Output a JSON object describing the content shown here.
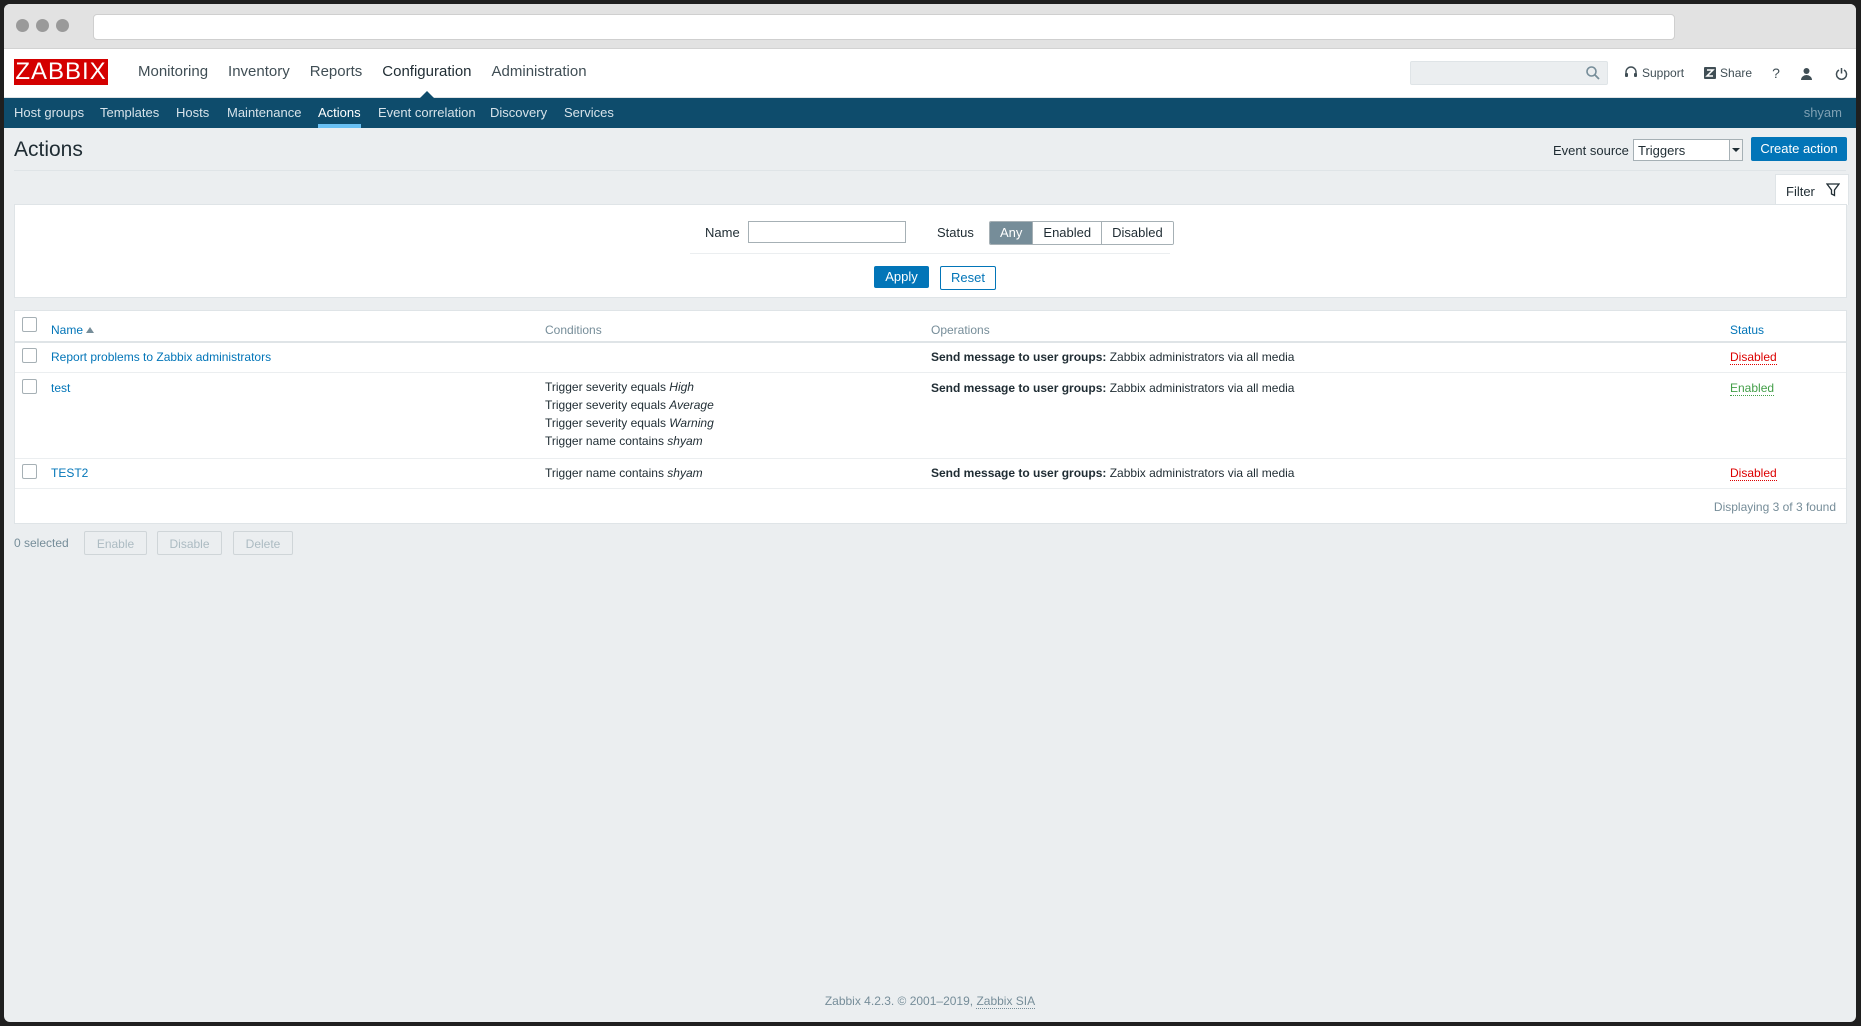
{
  "browser": {
    "url": ""
  },
  "logo": "ZABBIX",
  "mainmenu": [
    "Monitoring",
    "Inventory",
    "Reports",
    "Configuration",
    "Administration"
  ],
  "toplinks": {
    "support": "Support",
    "share": "Share",
    "help": "?"
  },
  "submenu": [
    "Host groups",
    "Templates",
    "Hosts",
    "Maintenance",
    "Actions",
    "Event correlation",
    "Discovery",
    "Services"
  ],
  "user": "shyam",
  "page": {
    "title": "Actions",
    "event_source_label": "Event source",
    "event_source_value": "Triggers",
    "create_button": "Create action"
  },
  "filter": {
    "tab_label": "Filter",
    "name_label": "Name",
    "name_value": "",
    "status_label": "Status",
    "status_options": [
      "Any",
      "Enabled",
      "Disabled"
    ],
    "status_selected": "Any",
    "apply": "Apply",
    "reset": "Reset"
  },
  "table": {
    "headers": {
      "name": "Name",
      "conditions": "Conditions",
      "operations": "Operations",
      "status": "Status"
    },
    "rows": [
      {
        "name": "Report problems to Zabbix administrators",
        "conditions": [],
        "op_bold": "Send message to user groups:",
        "op_text": " Zabbix administrators via all media",
        "status": "Disabled"
      },
      {
        "name": "test",
        "conditions": [
          {
            "text": "Trigger severity equals ",
            "em": "High"
          },
          {
            "text": "Trigger severity equals ",
            "em": "Average"
          },
          {
            "text": "Trigger severity equals ",
            "em": "Warning"
          },
          {
            "text": "Trigger name contains ",
            "em": "shyam"
          }
        ],
        "op_bold": "Send message to user groups:",
        "op_text": " Zabbix administrators via all media",
        "status": "Enabled"
      },
      {
        "name": "TEST2",
        "conditions": [
          {
            "text": "Trigger name contains ",
            "em": "shyam"
          }
        ],
        "op_bold": "Send message to user groups:",
        "op_text": " Zabbix administrators via all media",
        "status": "Disabled"
      }
    ],
    "paging": "Displaying 3 of 3 found"
  },
  "bulk": {
    "selected": "0 selected",
    "enable": "Enable",
    "disable": "Disable",
    "delete": "Delete"
  },
  "footer": {
    "text": "Zabbix 4.2.3. © 2001–2019, ",
    "link": "Zabbix SIA"
  },
  "colors": {
    "brand_red": "#d40000",
    "nav_blue": "#0e4c6c",
    "primary": "#0275b8",
    "disabled": "#dc0000",
    "enabled": "#429e47"
  }
}
